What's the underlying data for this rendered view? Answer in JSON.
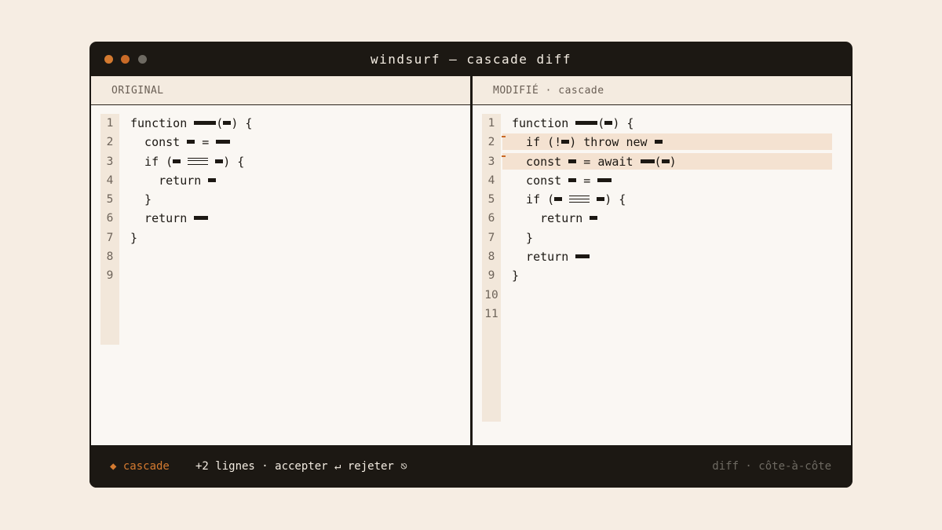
{
  "window": {
    "title": "windsurf — cascade diff",
    "accent_color": "#d47a30"
  },
  "left_pane": {
    "header": "ORIGINAL",
    "lines": [
      {
        "num": "1",
        "html": "function <span class='r w3'></span>(<span class='r w1'></span>) {"
      },
      {
        "num": "2",
        "html": "  const <span class='r w1'></span> = <span class='r w2'></span>"
      },
      {
        "num": "3",
        "html": "  if (<span class='r w1'></span> <span class='eq3'></span> <span class='r w1'></span>) {"
      },
      {
        "num": "4",
        "html": "    return <span class='r w1'></span>"
      },
      {
        "num": "5",
        "html": "  }"
      },
      {
        "num": "6",
        "html": "  return <span class='r w2'></span>"
      },
      {
        "num": "7",
        "html": "}"
      },
      {
        "num": "8",
        "html": ""
      },
      {
        "num": "9",
        "html": ""
      }
    ]
  },
  "right_pane": {
    "header": "MODIFIÉ · cascade",
    "lines": [
      {
        "num": "1",
        "added": false,
        "html": "function <span class='r w3'></span>(<span class='r w1'></span>) {"
      },
      {
        "num": "2",
        "added": true,
        "html": "  if (!<span class='r w1'></span>) throw new <span class='r w1'></span>"
      },
      {
        "num": "3",
        "added": true,
        "html": "  const <span class='r w1'></span> = await <span class='r w2'></span>(<span class='r w1'></span>)"
      },
      {
        "num": "4",
        "added": false,
        "html": "  const <span class='r w1'></span> = <span class='r w2'></span>"
      },
      {
        "num": "5",
        "added": false,
        "html": "  if (<span class='r w1'></span> <span class='eq3'></span> <span class='r w1'></span>) {"
      },
      {
        "num": "6",
        "added": false,
        "html": "    return <span class='r w1'></span>"
      },
      {
        "num": "7",
        "added": false,
        "html": "  }"
      },
      {
        "num": "8",
        "added": false,
        "html": "  return <span class='r w2'></span>"
      },
      {
        "num": "9",
        "added": false,
        "html": "}"
      },
      {
        "num": "10",
        "added": false,
        "html": ""
      },
      {
        "num": "11",
        "added": false,
        "html": ""
      }
    ]
  },
  "statusbar": {
    "agent": "◆ cascade",
    "summary": "+2 lignes · accepter ↵ rejeter ⎋",
    "mode": "diff · côte-à-côte"
  }
}
